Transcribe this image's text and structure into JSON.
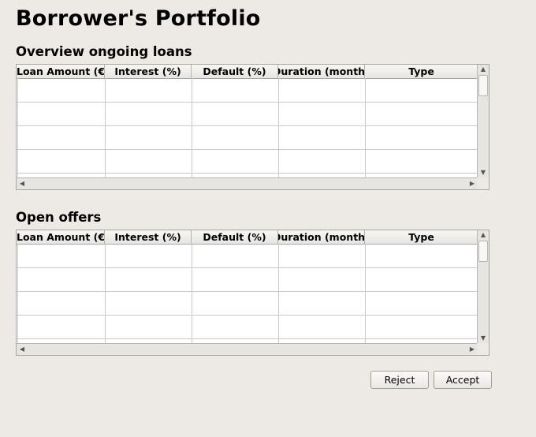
{
  "page": {
    "title": "Borrower's Portfolio"
  },
  "ongoing": {
    "title": "Overview ongoing loans",
    "columns": [
      "Loan Amount (€)",
      "Interest (%)",
      "Default (%)",
      "Duration (months)",
      "Type"
    ]
  },
  "offers": {
    "title": "Open offers",
    "columns": [
      "Loan Amount (€)",
      "Interest (%)",
      "Default (%)",
      "Duration (months)",
      "Type"
    ]
  },
  "actions": {
    "reject_label": "Reject",
    "accept_label": "Accept"
  }
}
